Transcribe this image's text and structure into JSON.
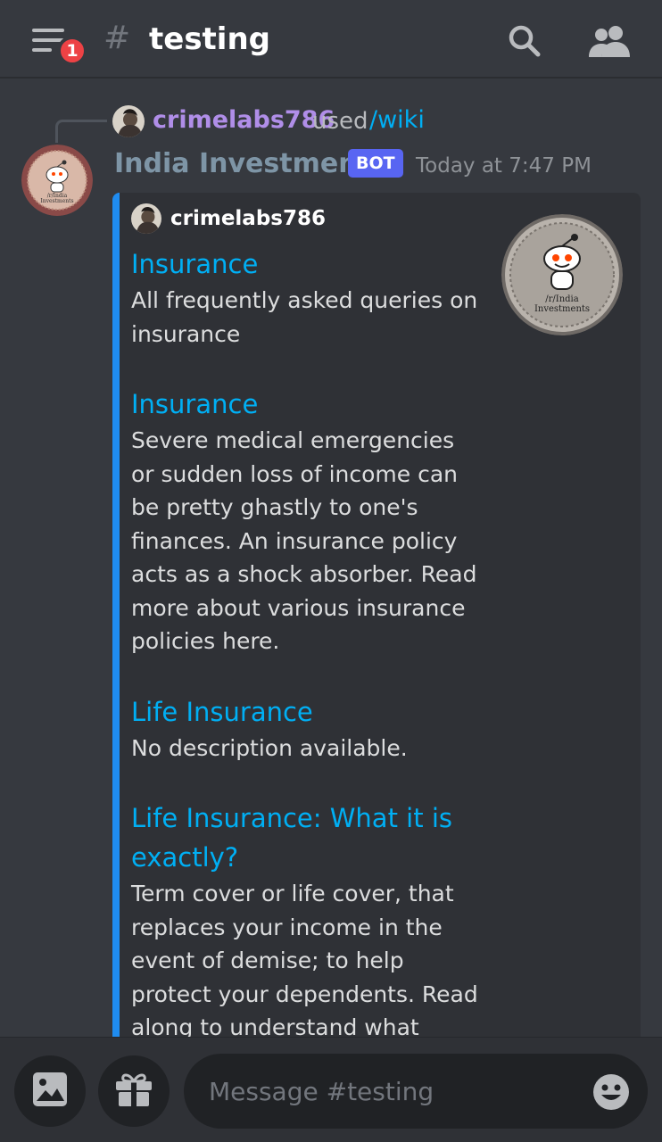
{
  "header": {
    "notification_count": "1",
    "hash": "#",
    "channel_name": "testing"
  },
  "reply": {
    "username": "crimelabs786",
    "used_text": "used",
    "command": "/wiki"
  },
  "message": {
    "author": "India Investments",
    "bot_tag": "BOT",
    "timestamp": "Today at 7:47 PM",
    "embed": {
      "author": "crimelabs786",
      "thumbnail_text": [
        "/r/India",
        "Investments"
      ],
      "entries": [
        {
          "title": "Insurance",
          "description": "All frequently asked queries on insurance"
        },
        {
          "title": "Insurance",
          "description": "Severe medical emergencies or sudden loss of income can be pretty ghastly to one's finances. An insurance policy acts as a shock absorber. Read more about various insurance policies here."
        },
        {
          "title": "Life Insurance",
          "description": "No description available."
        },
        {
          "title": "Life Insurance: What it is exactly?",
          "description": "Term cover or life cover, that replaces your income in the event of demise; to help protect your dependents. Read along to understand what"
        }
      ]
    }
  },
  "composer": {
    "placeholder": "Message #testing"
  },
  "icons": {
    "menu": "hamburger-menu-icon",
    "search": "search-icon",
    "members": "members-icon",
    "image": "image-icon",
    "gift": "gift-icon",
    "emoji": "emoji-icon"
  },
  "colors": {
    "background": "#36393f",
    "embed_accent": "#1f8cf0",
    "link": "#00aff4",
    "bot_tag": "#5865f2",
    "badge": "#ed4245"
  }
}
